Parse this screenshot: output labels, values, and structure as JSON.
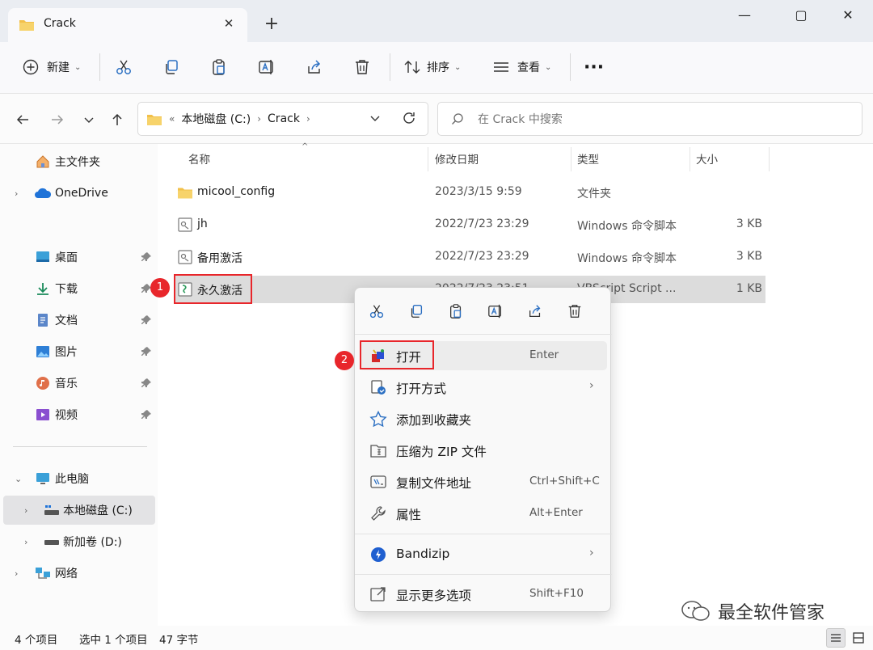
{
  "window": {
    "tab_title": "Crack",
    "new_tab": "+",
    "minimize": "—",
    "maximize": "▢",
    "close": "✕"
  },
  "toolbar": {
    "new_label": "新建",
    "sort_label": "排序",
    "view_label": "查看",
    "more": "···"
  },
  "address": {
    "prefix": "«",
    "segments": [
      "本地磁盘 (C:)",
      "Crack"
    ],
    "search_placeholder": "在 Crack 中搜索"
  },
  "sidebar": {
    "home": "主文件夹",
    "onedrive": "OneDrive",
    "quick": [
      {
        "label": "桌面",
        "icon": "desktop-icon"
      },
      {
        "label": "下载",
        "icon": "download-icon"
      },
      {
        "label": "文档",
        "icon": "document-icon"
      },
      {
        "label": "图片",
        "icon": "picture-icon"
      },
      {
        "label": "音乐",
        "icon": "music-icon"
      },
      {
        "label": "视频",
        "icon": "video-icon"
      }
    ],
    "this_pc": "此电脑",
    "drives": [
      "本地磁盘 (C:)",
      "新加卷 (D:)"
    ],
    "network": "网络"
  },
  "columns": {
    "name": "名称",
    "modified": "修改日期",
    "type": "类型",
    "size": "大小"
  },
  "files": [
    {
      "name": "micool_config",
      "modified": "2023/3/15 9:59",
      "type": "文件夹",
      "size": ""
    },
    {
      "name": "jh",
      "modified": "2022/7/23 23:29",
      "type": "Windows 命令脚本",
      "size": "3 KB"
    },
    {
      "name": "备用激活",
      "modified": "2022/7/23 23:29",
      "type": "Windows 命令脚本",
      "size": "3 KB"
    },
    {
      "name": "永久激活",
      "modified": "2022/7/23 23:51",
      "type": "VBScript Script ...",
      "size": "1 KB"
    }
  ],
  "context_menu": {
    "items": [
      {
        "label": "打开",
        "shortcut": "Enter"
      },
      {
        "label": "打开方式",
        "shortcut": ""
      },
      {
        "label": "添加到收藏夹",
        "shortcut": ""
      },
      {
        "label": "压缩为 ZIP 文件",
        "shortcut": ""
      },
      {
        "label": "复制文件地址",
        "shortcut": "Ctrl+Shift+C"
      },
      {
        "label": "属性",
        "shortcut": "Alt+Enter"
      },
      {
        "label": "Bandizip",
        "shortcut": ""
      },
      {
        "label": "显示更多选项",
        "shortcut": "Shift+F10"
      }
    ]
  },
  "annotations": {
    "badge1": "1",
    "badge2": "2"
  },
  "status": {
    "count": "4 个项目",
    "selected": "选中 1 个项目",
    "bytes": "47 字节"
  },
  "watermark": "最全软件管家"
}
